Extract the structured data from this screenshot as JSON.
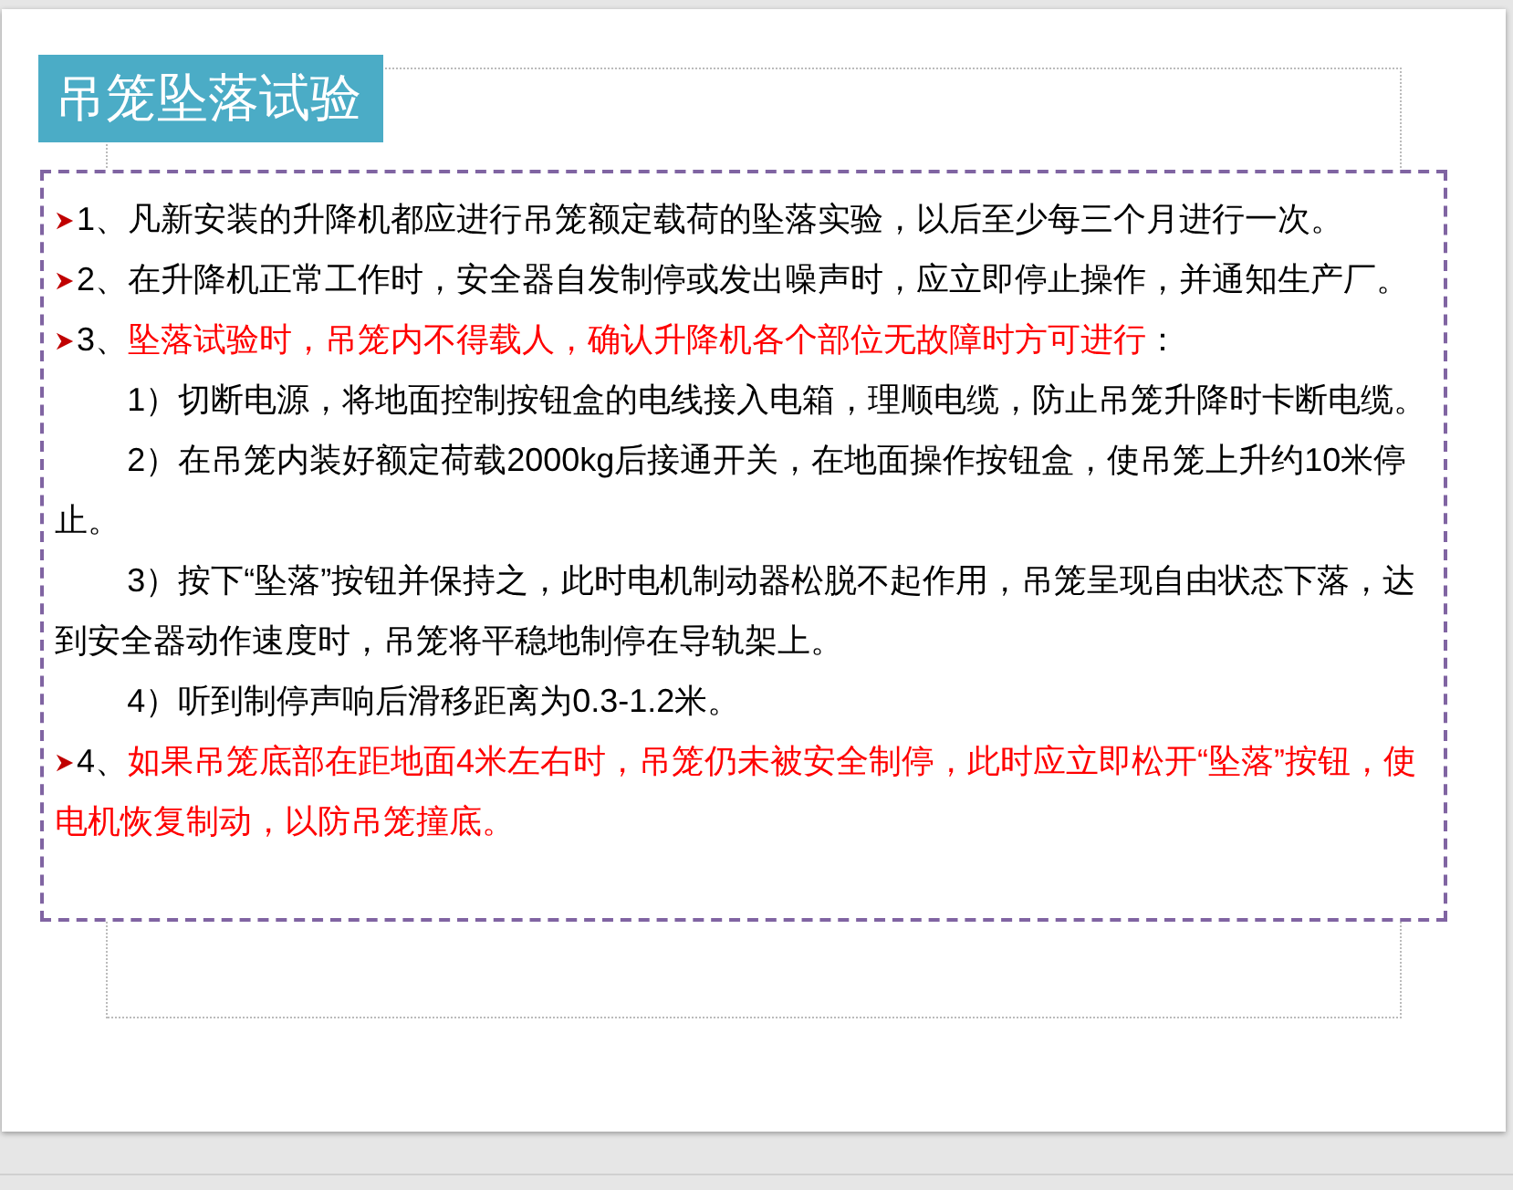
{
  "slide": {
    "title": "吊笼坠落试验",
    "paragraphs": [
      {
        "kind": "bullet",
        "number": "1、",
        "segments": [
          {
            "text": "凡新安装的升降机都应进行吊笼额定载荷的坠落实验，以后至少每三个月进行一次。",
            "emphasis": false
          }
        ]
      },
      {
        "kind": "bullet",
        "number": "2、",
        "segments": [
          {
            "text": "在升降机正常工作时，安全器自发制停或发出噪声时，应立即停止操作，并通知生产厂。",
            "emphasis": false
          }
        ]
      },
      {
        "kind": "bullet",
        "number": "3、",
        "segments": [
          {
            "text": "坠落试验时，吊笼内不得载人，确认升降机各个部位无故障时方可进行",
            "emphasis": true
          },
          {
            "text": "：",
            "emphasis": false
          }
        ]
      },
      {
        "kind": "indent",
        "number": "1）",
        "segments": [
          {
            "text": "切断电源，将地面控制按钮盒的电线接入电箱，理顺电缆，防止吊笼升降时卡断电缆。",
            "emphasis": false
          }
        ]
      },
      {
        "kind": "indent",
        "number": "2）",
        "segments": [
          {
            "text": "在吊笼内装好额定荷载2000kg后接通开关，在地面操作按钮盒，使吊笼上升约10米停止。",
            "emphasis": false
          }
        ]
      },
      {
        "kind": "indent",
        "number": "3）",
        "segments": [
          {
            "text": "按下“坠落”按钮并保持之，此时电机制动器松脱不起作用，吊笼呈现自由状态下落，达到安全器动作速度时，吊笼将平稳地制停在导轨架上。",
            "emphasis": false
          }
        ]
      },
      {
        "kind": "indent",
        "number": "4）",
        "segments": [
          {
            "text": "听到制停声响后滑移距离为0.3-1.2米。",
            "emphasis": false
          }
        ]
      },
      {
        "kind": "bullet",
        "number": "4、",
        "segments": [
          {
            "text": "如果吊笼底部在距地面4米左右时，吊笼仍未被安全制停，此时应立即松开“坠落”按钮，使电机恢复制动，以防吊笼撞底。",
            "emphasis": true
          }
        ]
      }
    ]
  }
}
